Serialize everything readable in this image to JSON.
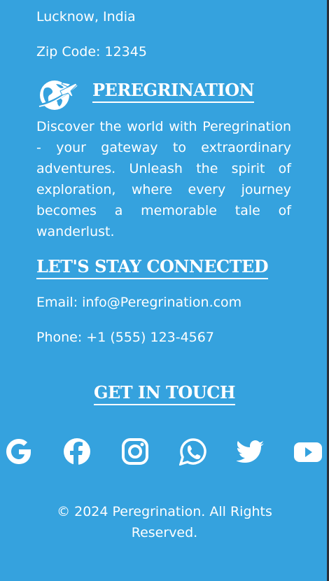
{
  "address": {
    "city_line": "Lucknow, India",
    "zip_line": "Zip Code: 12345"
  },
  "brand": {
    "name": "PEREGRINATION",
    "icon": "globe-airplane-icon",
    "description": "Discover the world with Peregrination - your gateway to extraordinary adventures. Unleash the spirit of exploration, where every journey becomes a memorable tale of wanderlust."
  },
  "contact": {
    "heading": "LET'S STAY CONNECTED",
    "email": "Email: info@Peregrination.com",
    "phone": "Phone: +1 (555) 123-4567"
  },
  "social": {
    "heading": "GET IN TOUCH",
    "icons": [
      "google-icon",
      "facebook-icon",
      "instagram-icon",
      "whatsapp-icon",
      "twitter-icon",
      "youtube-icon"
    ]
  },
  "footer": {
    "copyright": "© 2024 Peregrination. All Rights Reserved."
  },
  "colors": {
    "background": "#35a2de",
    "text": "#ffffff"
  }
}
